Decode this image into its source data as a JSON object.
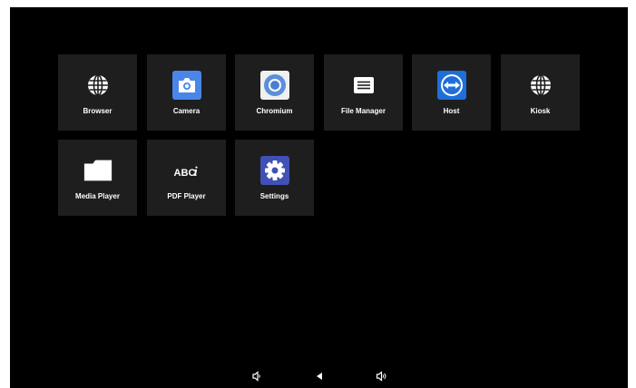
{
  "apps": [
    {
      "label": "Browser",
      "icon": "globe-icon"
    },
    {
      "label": "Camera",
      "icon": "camera-icon",
      "icon_bg": "#4a86e8"
    },
    {
      "label": "Chromium",
      "icon": "chromium-icon",
      "icon_bg": "#f0f0f0"
    },
    {
      "label": "File Manager",
      "icon": "file-manager-icon"
    },
    {
      "label": "Host",
      "icon": "teamviewer-icon",
      "icon_bg": "#1e6fd9"
    },
    {
      "label": "Kiosk",
      "icon": "globe-icon"
    },
    {
      "label": "Media Player",
      "icon": "folder-icon"
    },
    {
      "label": "PDF Player",
      "icon": "abc-text-icon",
      "icon_text": "ABCi"
    },
    {
      "label": "Settings",
      "icon": "gear-icon",
      "icon_bg": "#3f51b5"
    }
  ],
  "navbar": {
    "buttons": [
      "volume-down-icon",
      "back-icon",
      "volume-up-icon"
    ]
  },
  "colors": {
    "screen_bg": "#000000",
    "tile_bg": "#1e1e1e",
    "label": "#ffffff"
  }
}
